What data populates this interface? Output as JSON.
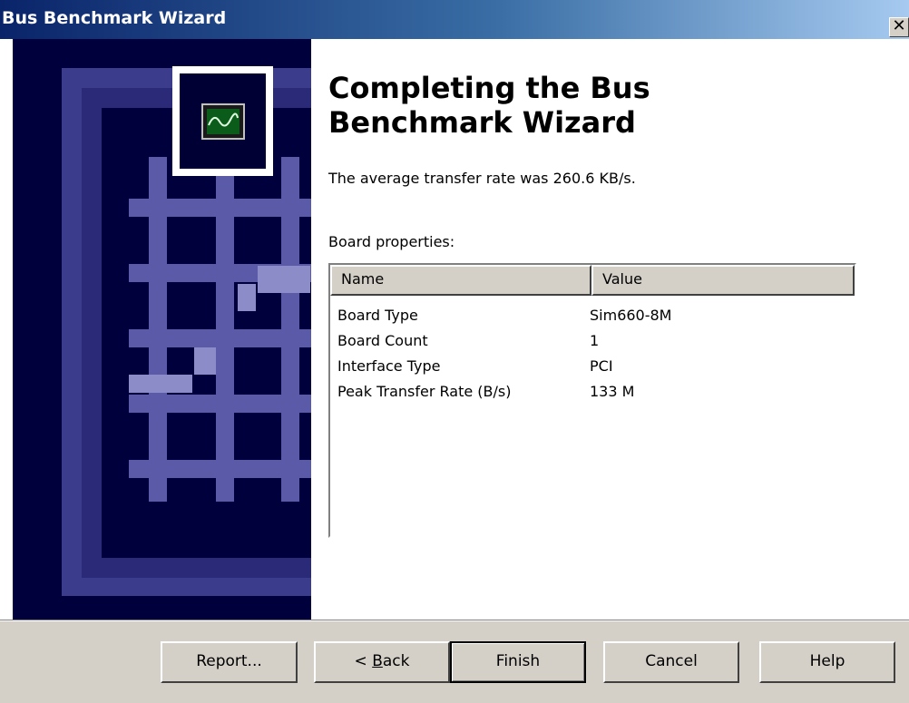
{
  "window": {
    "title": "Bus Benchmark Wizard",
    "close_glyph": "✕"
  },
  "heading": {
    "line1": "Completing the Bus",
    "line2": "Benchmark Wizard"
  },
  "summary": {
    "rate_text": "The average transfer rate was 260.6 KB/s."
  },
  "properties": {
    "label": "Board properties:",
    "columns": [
      "Name",
      "Value"
    ],
    "rows": [
      {
        "name": "Board Type",
        "value": "Sim660-8M"
      },
      {
        "name": "Board Count",
        "value": "1"
      },
      {
        "name": "Interface Type",
        "value": "PCI"
      },
      {
        "name": "Peak Transfer Rate (B/s)",
        "value": "133 M"
      }
    ]
  },
  "buttons": {
    "report": "Report...",
    "back_prefix": "< ",
    "back_mnemonic": "B",
    "back_rest": "ack",
    "finish": "Finish",
    "cancel": "Cancel",
    "help": "Help"
  },
  "icons": {
    "wizard_icon": "oscilloscope-monitor-icon"
  },
  "colors": {
    "titlebar_start": "#0a246a",
    "titlebar_end": "#a6caf0",
    "sidebar_bg": "#00003c",
    "face": "#d4d0c8"
  }
}
